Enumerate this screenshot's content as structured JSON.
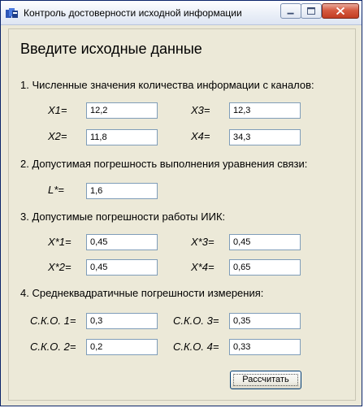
{
  "window": {
    "title": "Контроль достоверности исходной информации"
  },
  "heading": "Введите исходные данные",
  "sections": {
    "s1": "1. Численные значения количества информации с каналов:",
    "s2": "2. Допустимая погрешность выполнения уравнения связи:",
    "s3": "3. Допустимые погрешности работы ИИК:",
    "s4": "4. Среднеквадратичные погрешности измерения:"
  },
  "fields": {
    "x1": {
      "label": "X1=",
      "value": "12,2"
    },
    "x2": {
      "label": "X2=",
      "value": "11,8"
    },
    "x3": {
      "label": "X3=",
      "value": "12,3"
    },
    "x4": {
      "label": "X4=",
      "value": "34,3"
    },
    "l": {
      "label": "L*=",
      "value": "1,6"
    },
    "xs1": {
      "label": "X*1=",
      "value": "0,45"
    },
    "xs2": {
      "label": "X*2=",
      "value": "0,45"
    },
    "xs3": {
      "label": "X*3=",
      "value": "0,45"
    },
    "xs4": {
      "label": "X*4=",
      "value": "0,65"
    },
    "sko1": {
      "label": "С.К.О. 1=",
      "value": "0,3"
    },
    "sko2": {
      "label": "С.К.О. 2=",
      "value": "0,2"
    },
    "sko3": {
      "label": "С.К.О. 3=",
      "value": "0,35"
    },
    "sko4": {
      "label": "С.К.О. 4=",
      "value": "0,33"
    }
  },
  "buttons": {
    "calculate": "Рассчитать"
  },
  "colors": {
    "titlebar": "#e6ecf7",
    "close_button": "#c9452b",
    "window_background": "#ece9d8",
    "field_border": "#7f9db9"
  },
  "icons": {
    "app": "app-icon",
    "minimize": "minimize-icon",
    "maximize": "maximize-icon",
    "close": "close-icon"
  }
}
